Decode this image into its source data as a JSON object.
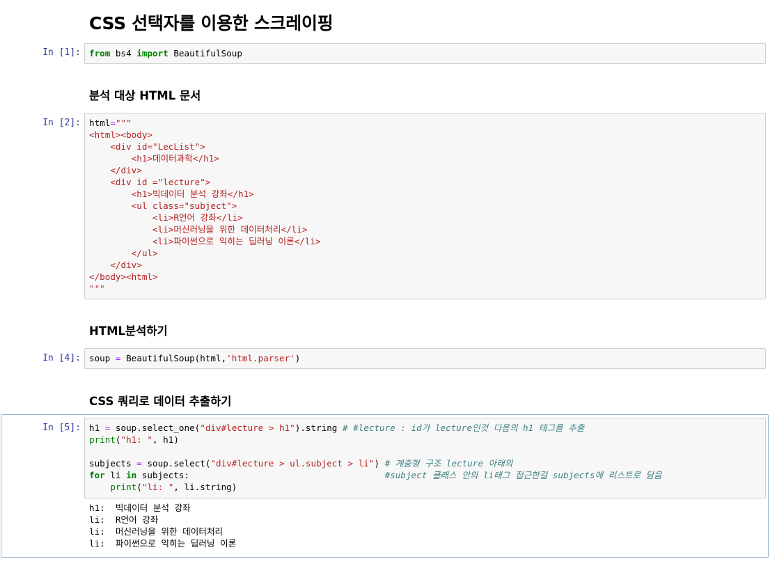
{
  "headings": {
    "title": "CSS 선택자를 이용한 스크레이핑",
    "h_doc": "분석 대상 HTML 문서",
    "h_parse": "HTML분석하기",
    "h_query": "CSS 쿼리로 데이터 추출하기"
  },
  "prompts": {
    "c1": "In [1]:",
    "c2": "In [2]:",
    "c4": "In [4]:",
    "c5": "In [5]:"
  },
  "cell1": {
    "kw_from": "from",
    "module": " bs4 ",
    "kw_import": "import",
    "name": " BeautifulSoup"
  },
  "cell2": {
    "var": "html",
    "eq": "=",
    "lines": [
      "\"\"\"",
      "<html><body>",
      "    <div id=\"LecList\">",
      "        <h1>데이터과학</h1>",
      "    </div>",
      "    <div id =\"lecture\">",
      "        <h1>빅데이터 분석 강좌</h1>",
      "        <ul class=\"subject\">",
      "            <li>R언어 강좌</li>",
      "            <li>머신러닝을 위한 데이터처리</li>",
      "            <li>파이썬으로 익히는 딥러닝 이론</li>",
      "        </ul>",
      "    </div>",
      "</body><html>",
      "\"\"\""
    ]
  },
  "cell4": {
    "lhs": "soup ",
    "eq": "=",
    "call": " BeautifulSoup(html,",
    "arg": "'html.parser'",
    "close": ")"
  },
  "cell5": {
    "l1_a": "h1 ",
    "l1_eq": "=",
    "l1_b": " soup.select_one(",
    "l1_str": "\"div#lecture > h1\"",
    "l1_c": ").string ",
    "l1_cm": "# #lecture : id가 lecture인것 다음의 h1 태그를 추출",
    "l2_fn": "print",
    "l2_a": "(",
    "l2_str": "\"h1: \"",
    "l2_b": ", h1)",
    "l4_a": "subjects ",
    "l4_eq": "=",
    "l4_b": " soup.select(",
    "l4_str": "\"div#lecture > ul.subject > li\"",
    "l4_c": ") ",
    "l4_cm": "# 계층형 구조 lecture 아래의",
    "l5_for": "for",
    "l5_a": " li ",
    "l5_in": "in",
    "l5_b": " subjects:                                     ",
    "l5_cm": "#subject 클래스 안의 li태그 접근한걸 subjects에 리스트로 담음",
    "l6_ind": "    ",
    "l6_fn": "print",
    "l6_a": "(",
    "l6_str": "\"li: \"",
    "l6_b": ", li.string)"
  },
  "output": [
    "h1:  빅데이터 분석 강좌",
    "li:  R언어 강좌",
    "li:  머신러닝을 위한 데이터처리",
    "li:  파이썬으로 익히는 딥러닝 이론"
  ],
  "colors": {
    "keyword": "#008000",
    "string": "#ba2121",
    "operator": "#aa22ff",
    "comment": "#408080",
    "prompt": "#303f9f",
    "selected_border": "#9ab6d1"
  }
}
